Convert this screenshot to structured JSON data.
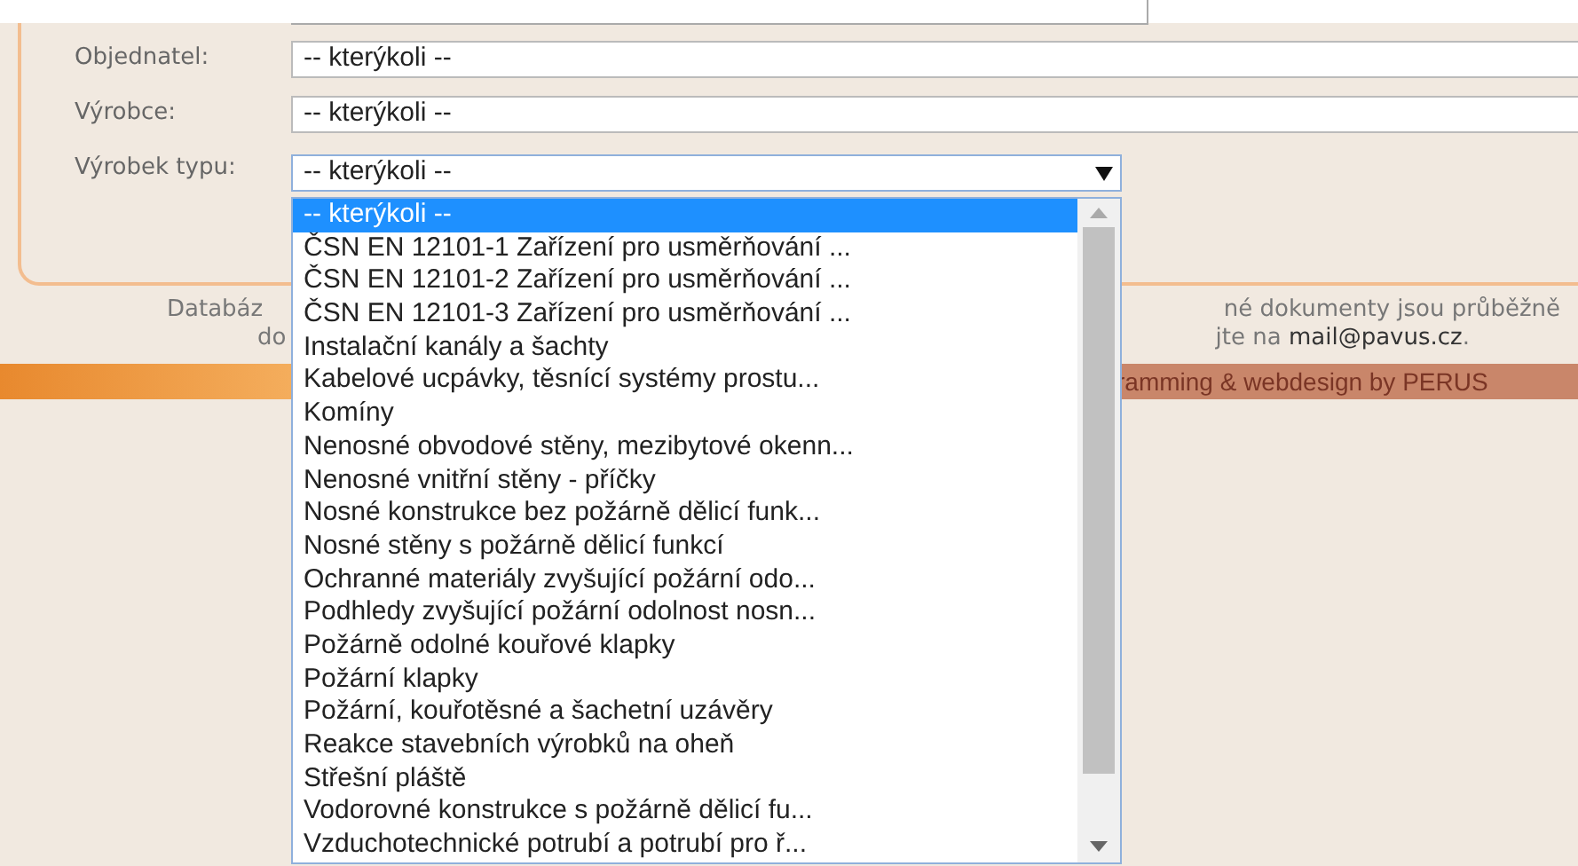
{
  "filters": [
    {
      "label": "Objednatel:",
      "value": "-- kterýkoli --"
    },
    {
      "label": "Výrobce:",
      "value": "-- kterýkoli --"
    },
    {
      "label": "Výrobek typu:",
      "value": "-- kterýkoli --",
      "open": true,
      "options": [
        {
          "label": "-- kterýkoli --",
          "selected": true
        },
        {
          "label": "ČSN EN 12101-1 Zařízení pro usměrňování ...",
          "selected": false
        },
        {
          "label": "ČSN EN 12101-2 Zařízení pro usměrňování ...",
          "selected": false
        },
        {
          "label": "ČSN EN 12101-3 Zařízení pro usměrňování ...",
          "selected": false
        },
        {
          "label": "Instalační kanály a šachty",
          "selected": false
        },
        {
          "label": "Kabelové ucpávky, těsnící systémy prostu...",
          "selected": false
        },
        {
          "label": "Komíny",
          "selected": false
        },
        {
          "label": "Nenosné obvodové stěny, mezibytové okenn...",
          "selected": false
        },
        {
          "label": "Nenosné vnitřní stěny - příčky",
          "selected": false
        },
        {
          "label": "Nosné konstrukce bez požárně dělicí funk...",
          "selected": false
        },
        {
          "label": "Nosné stěny s požárně dělicí funkcí",
          "selected": false
        },
        {
          "label": "Ochranné materiály zvyšující požární odo...",
          "selected": false
        },
        {
          "label": "Podhledy zvyšující požární odolnost nosn...",
          "selected": false
        },
        {
          "label": "Požárně odolné kouřové klapky",
          "selected": false
        },
        {
          "label": "Požární klapky",
          "selected": false
        },
        {
          "label": "Požární, kouřotěsné a šachetní uzávěry",
          "selected": false
        },
        {
          "label": "Reakce stavebních výrobků na oheň",
          "selected": false
        },
        {
          "label": "Střešní pláště",
          "selected": false
        },
        {
          "label": "Vodorovné konstrukce s požárně dělicí fu...",
          "selected": false
        },
        {
          "label": "Vzduchotechnické potrubí a potrubí pro ř...",
          "selected": false
        }
      ]
    }
  ],
  "footer": {
    "line_1_left": "Databáz",
    "line_1_right": "né dokumenty jsou průběžně",
    "line_2_left": "do",
    "line_2_right": "jte na",
    "email": "mail@pavus.cz",
    "line_2_end": "."
  },
  "credits": "ramming & webdesign by PERUS"
}
